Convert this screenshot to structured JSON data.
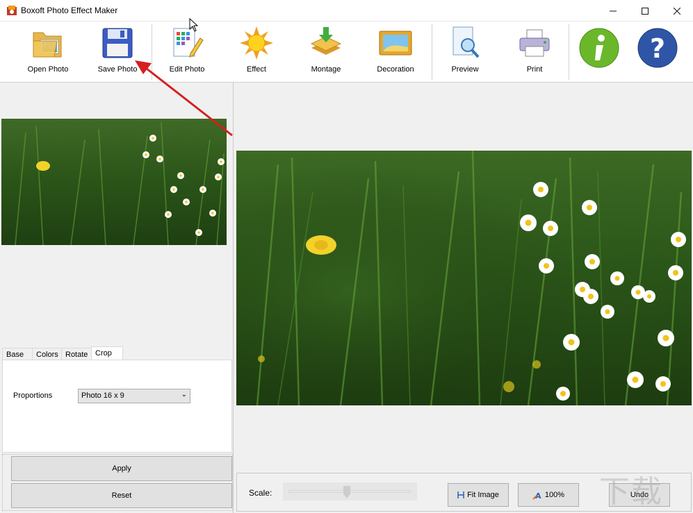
{
  "window": {
    "title": "Boxoft Photo Effect Maker"
  },
  "toolbar": {
    "open_photo": "Open Photo",
    "save_photo": "Save Photo",
    "edit_photo": "Edit Photo",
    "effect": "Effect",
    "montage": "Montage",
    "decoration": "Decoration",
    "preview": "Preview",
    "print": "Print"
  },
  "tabs": [
    "Base",
    "Colors",
    "Rotate",
    "Crop"
  ],
  "active_tab": "Crop",
  "crop": {
    "proportions_label": "Proportions",
    "proportions_value": "Photo 16 x 9"
  },
  "buttons": {
    "apply": "Apply",
    "reset": "Reset"
  },
  "bottom": {
    "scale_label": "Scale:",
    "scale_fraction": 0.48,
    "fit_image": "Fit Image",
    "zoom_100": "100%",
    "undo": "Undo"
  },
  "colors": {
    "annotation_arrow": "#d42020",
    "grass": "#2f5a1c"
  }
}
